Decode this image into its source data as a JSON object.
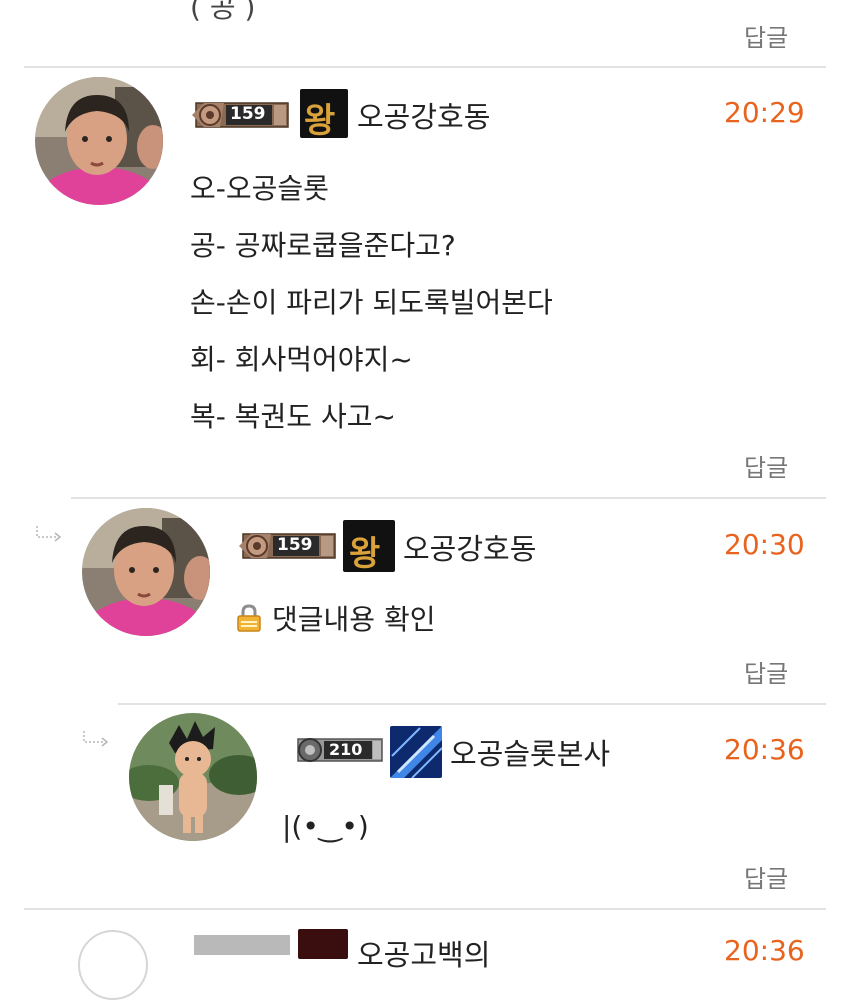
{
  "top_fragment": {
    "text_partial": "( 공 )",
    "reply_label": "답글"
  },
  "comments": [
    {
      "level": "159",
      "rank_badge_text": "왕",
      "nickname": "오공강호동",
      "time": "20:29",
      "lines": [
        "오-오공슬롯",
        "공- 공짜로쿱을준다고?",
        "손-손이 파리가 되도록빌어본다",
        "회- 회사먹어야지~",
        "복- 복권도 사고~"
      ],
      "reply_label": "답글"
    },
    {
      "level": "159",
      "rank_badge_text": "왕",
      "nickname": "오공강호동",
      "time": "20:30",
      "locked_text": "댓글내용 확인",
      "reply_label": "답글"
    },
    {
      "level": "210",
      "nickname": "오공슬롯본사",
      "time": "20:36",
      "lines": [
        "|(•‿•)"
      ],
      "reply_label": "답글"
    },
    {
      "nickname_partial": "오공고백의",
      "time_partial": "20:36"
    }
  ],
  "colors": {
    "time": "#e8641e",
    "divider": "#e3e3e3",
    "reply_text": "#777777",
    "avatar_shirt": "#e0429a"
  },
  "icons": {
    "reply_arrow": "reply-arrow-icon",
    "lock": "lock-icon",
    "level_badge": "level-badge-icon",
    "rank_badge": "rank-badge-icon"
  }
}
